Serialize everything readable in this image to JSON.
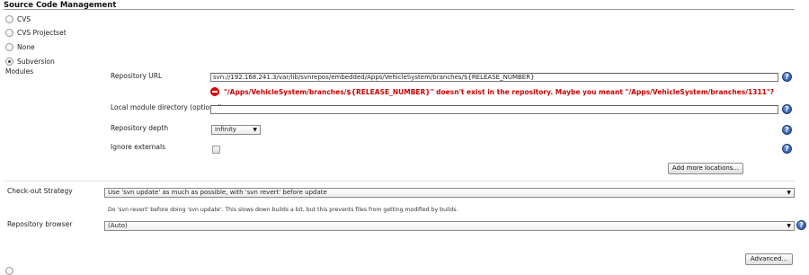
{
  "section": {
    "title": "Source Code Management"
  },
  "scm_options": [
    {
      "label": "CVS",
      "checked": false
    },
    {
      "label": "CVS Projectset",
      "checked": false
    },
    {
      "label": "None",
      "checked": false
    },
    {
      "label": "Subversion",
      "checked": true
    }
  ],
  "modules": {
    "label": "Modules",
    "repository_url": {
      "label": "Repository URL",
      "value": "svn://192.168.241.3/var/lib/svnrepos/embedded/Apps/VehicleSystem/branches/${RELEASE_NUMBER}",
      "error": "\"/Apps/VehicleSystem/branches/${RELEASE_NUMBER}\" doesn't exist in the repository. Maybe you meant \"/Apps/VehicleSystem/branches/1311\"?"
    },
    "local_module_directory": {
      "label": "Local module directory (optional)",
      "value": ""
    },
    "repository_depth": {
      "label": "Repository depth",
      "value": "infinity"
    },
    "ignore_externals": {
      "label": "Ignore externals",
      "checked": false
    },
    "add_more_locations_label": "Add more locations..."
  },
  "checkout_strategy": {
    "label": "Check-out Strategy",
    "value": "Use 'svn update' as much as possible, with 'svn revert' before update",
    "description": "Do 'svn revert' before doing 'svn update'. This slows down builds a bit, but this prevents files from getting modified by builds."
  },
  "repository_browser": {
    "label": "Repository browser",
    "value": "(Auto)"
  },
  "advanced_label": "Advanced...",
  "help_glyph": "?",
  "dropdown_glyph": "▼",
  "colors": {
    "error": "#cc0000",
    "help": "#3e67b5"
  }
}
